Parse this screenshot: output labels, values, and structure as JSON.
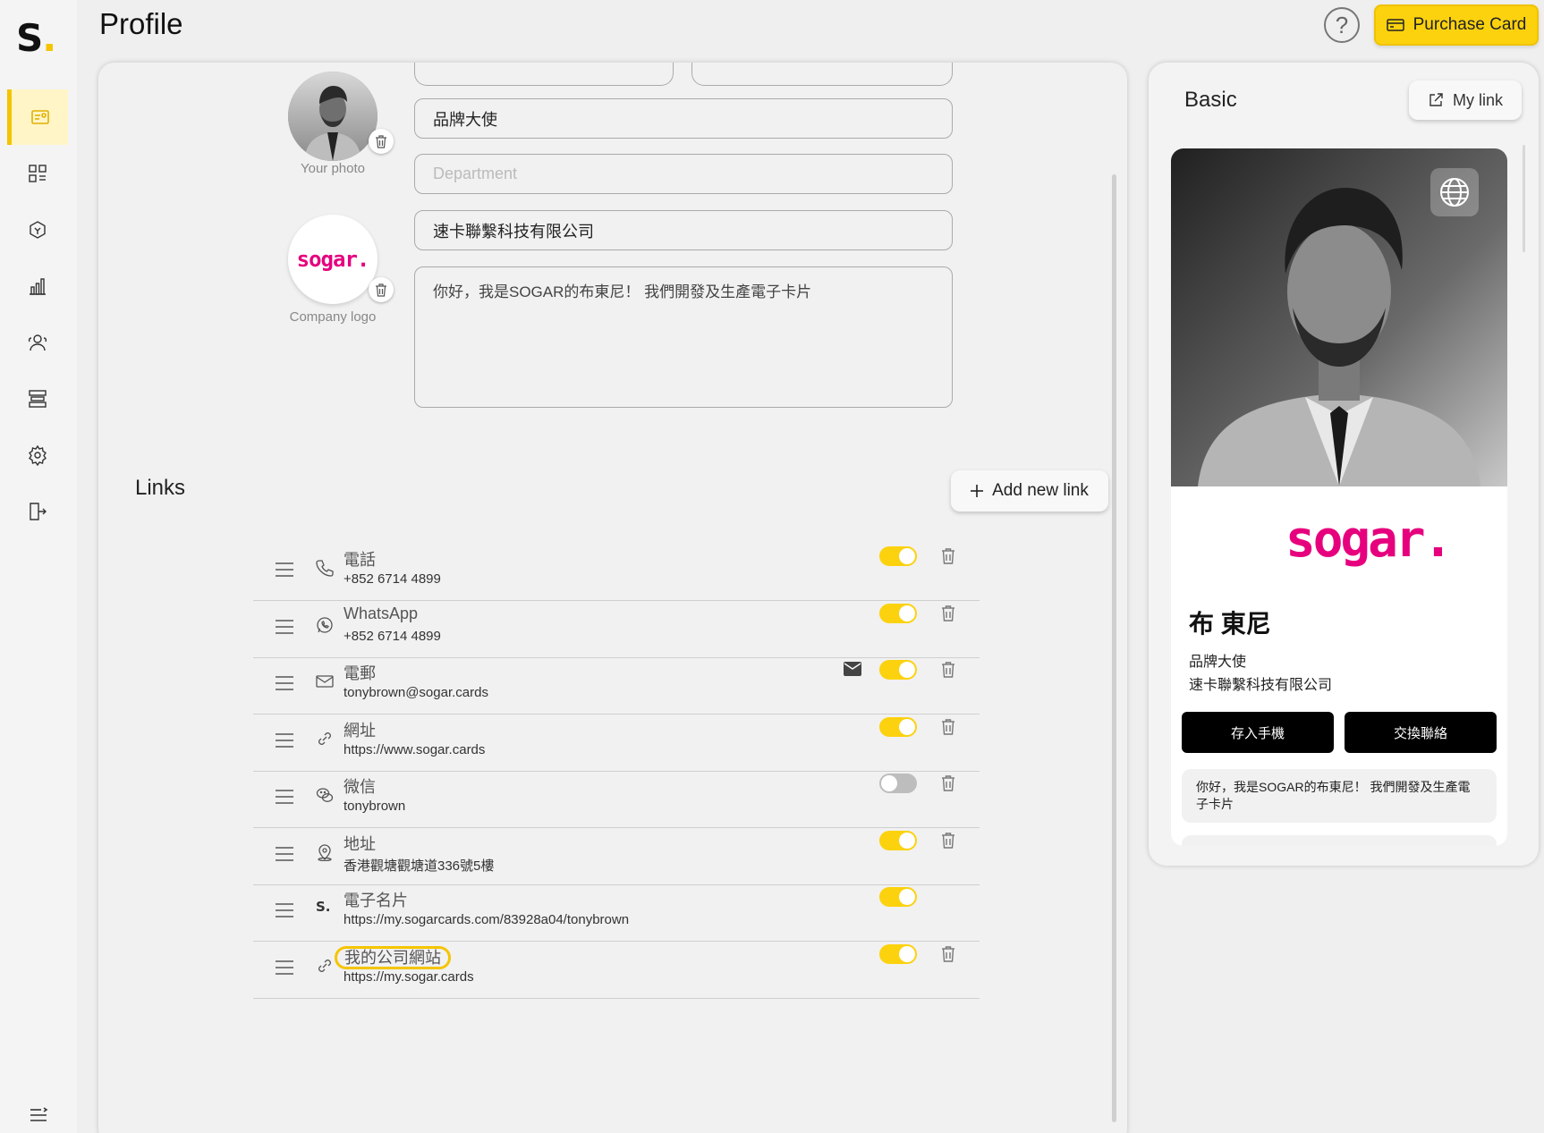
{
  "app": {
    "logo_letter": "S",
    "logo_dot": "."
  },
  "header": {
    "title": "Profile",
    "help_label": "?",
    "purchase_label": "Purchase Card"
  },
  "sidebar": {
    "items": [
      {
        "icon": "profile-card-icon",
        "active": true
      },
      {
        "icon": "dashboard-grid-icon",
        "active": false
      },
      {
        "icon": "hexagon-icon",
        "active": false
      },
      {
        "icon": "analytics-bars-icon",
        "active": false
      },
      {
        "icon": "contacts-icon",
        "active": false
      },
      {
        "icon": "servers-icon",
        "active": false
      },
      {
        "icon": "settings-gear-icon",
        "active": false
      },
      {
        "icon": "logout-icon",
        "active": false
      }
    ],
    "collapse_icon": "menu-collapse-icon"
  },
  "profile": {
    "photo_label": "Your photo",
    "logo_text": "sogar.",
    "logo_label": "Company logo",
    "job_title": "品牌大使",
    "department_placeholder": "Department",
    "company": "速卡聯繫科技有限公司",
    "bio": "你好，我是SOGAR的布東尼！ 我們開發及生產電子卡片"
  },
  "links": {
    "title": "Links",
    "add_label": "Add new link",
    "items": [
      {
        "label": "電話",
        "value": "+852 6714 4899",
        "icon": "phone-icon",
        "enabled": true,
        "deletable": true,
        "mail": false
      },
      {
        "label": "WhatsApp",
        "value": "+852 6714 4899",
        "icon": "whatsapp-icon",
        "enabled": true,
        "deletable": true,
        "mail": false
      },
      {
        "label": "電郵",
        "value": "tonybrown@sogar.cards",
        "icon": "email-icon",
        "enabled": true,
        "deletable": true,
        "mail": true
      },
      {
        "label": "網址",
        "value": "https://www.sogar.cards",
        "icon": "link-icon",
        "enabled": true,
        "deletable": true,
        "mail": false
      },
      {
        "label": "微信",
        "value": "tonybrown",
        "icon": "wechat-icon",
        "enabled": false,
        "deletable": true,
        "mail": false
      },
      {
        "label": "地址",
        "value": "香港觀塘觀塘道336號5樓",
        "icon": "location-pin-icon",
        "enabled": true,
        "deletable": true,
        "mail": false
      },
      {
        "label": "電子名片",
        "value": "https://my.sogarcards.com/83928a04/tonybrown",
        "icon": "sogar-s-icon",
        "enabled": true,
        "deletable": false,
        "mail": false
      },
      {
        "label": "我的公司網站",
        "value": "https://my.sogar.cards",
        "icon": "link-icon",
        "enabled": true,
        "deletable": true,
        "mail": false,
        "highlighted": true
      }
    ]
  },
  "preview": {
    "title": "Basic",
    "mylink_label": "My link",
    "card": {
      "logo_text": "sogar.",
      "name": "布 東尼",
      "job_title": "品牌大使",
      "company": "速卡聯繫科技有限公司",
      "save_label": "存入手機",
      "exchange_label": "交換聯絡",
      "bio": "你好，我是SOGAR的布東尼！ 我們開發及生產電子卡片"
    }
  },
  "colors": {
    "accent": "#fcd20f",
    "brand_pink": "#e6007e"
  }
}
